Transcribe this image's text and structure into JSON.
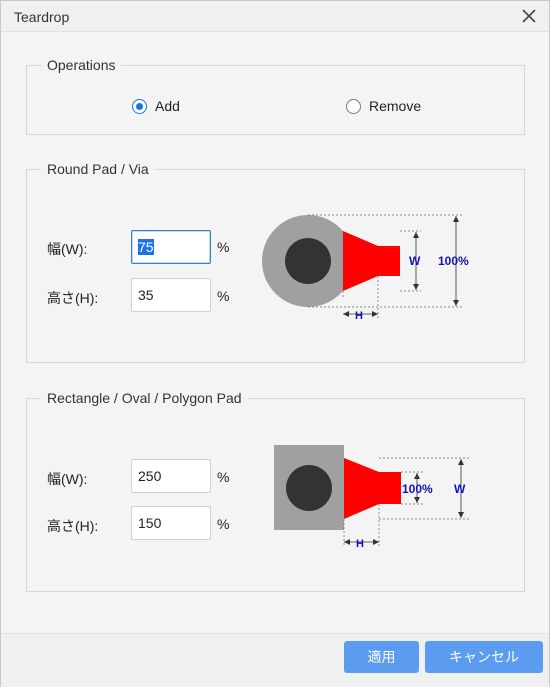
{
  "window": {
    "title": "Teardrop"
  },
  "operations": {
    "legend": "Operations",
    "options": [
      {
        "label": "Add",
        "checked": true
      },
      {
        "label": "Remove",
        "checked": false
      }
    ]
  },
  "round_pad": {
    "legend": "Round Pad / Via",
    "width_label": "幅(W):",
    "width_value": "75",
    "width_unit": "%",
    "height_label": "高さ(H):",
    "height_value": "35",
    "height_unit": "%",
    "diagram": {
      "w_label": "W",
      "pct_label": "100%",
      "h_label": "H"
    }
  },
  "rect_pad": {
    "legend": "Rectangle / Oval / Polygon Pad",
    "width_label": "幅(W):",
    "width_value": "250",
    "width_unit": "%",
    "height_label": "高さ(H):",
    "height_value": "150",
    "height_unit": "%",
    "diagram": {
      "pct_label": "100%",
      "w_label": "W",
      "h_label": "H"
    }
  },
  "footer": {
    "apply_label": "適用",
    "cancel_label": "キャンセル"
  },
  "colors": {
    "pad_gray": "#a0a0a0",
    "hole": "#333333",
    "teardrop_red": "#ff0000",
    "dimension_blue": "#1010c0",
    "button_blue": "#5b9cf0",
    "accent": "#1a73e8"
  }
}
